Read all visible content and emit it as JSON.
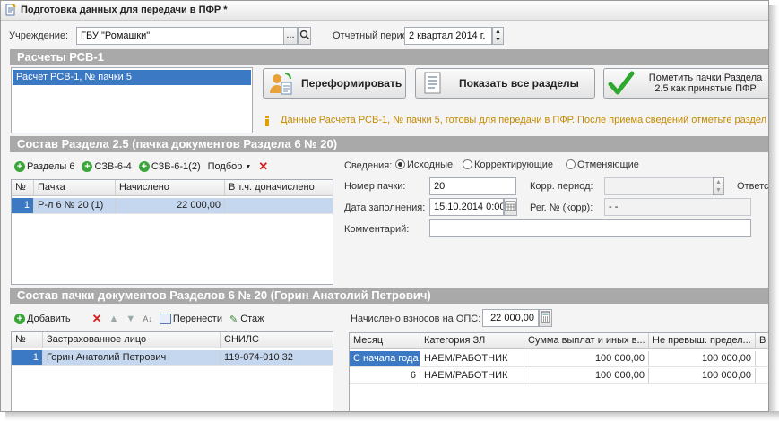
{
  "window": {
    "title": "Подготовка данных для передачи в ПФР *"
  },
  "header": {
    "institution_label": "Учреждение:",
    "institution_value": "ГБУ \"Ромашки\"",
    "ellipsis": "...",
    "period_label": "Отчетный период:",
    "period_value": "2 квартал 2014 г."
  },
  "rsv": {
    "section_title": "Расчеты РСВ-1",
    "list": [
      "Расчет РСВ-1, № пачки 5"
    ],
    "buttons": {
      "reform": "Переформировать",
      "show_all": "Показать все разделы",
      "mark_accepted": "Пометить пачки Раздела 2.5 как принятые ПФР"
    },
    "info_text": "Данные Расчета РСВ-1, № пачки 5, готовы для передачи в ПФР. После приема сведений отметьте раздел"
  },
  "section25": {
    "title": "Состав Раздела 2.5     (пачка документов Раздела 6 № 20)",
    "toolbar": {
      "razdely6": "Разделы 6",
      "szv64": "СЗВ-6-4",
      "szv61": "СЗВ-6-1(2)",
      "podbor": "Подбор"
    },
    "grid_headers": [
      "№",
      "Пачка",
      "Начислено",
      "В т.ч. доначислено"
    ],
    "grid_rows": [
      {
        "num": "1",
        "pack": "Р-л 6 № 20 (1)",
        "charged": "22 000,00",
        "extra": ""
      }
    ],
    "form": {
      "svedeniya_label": "Сведения:",
      "radio_options": [
        "Исходные",
        "Корректирующие",
        "Отменяющие"
      ],
      "pack_number_label": "Номер пачки:",
      "pack_number_value": "20",
      "corr_period_label": "Корр. период:",
      "corr_period_value": "",
      "response_label": "Ответст",
      "fill_date_label": "Дата заполнения:",
      "fill_date_value": "15.10.2014 0:00",
      "reg_corr_label": "Рег. № (корр):",
      "reg_corr_value": "-  -",
      "comment_label": "Комментарий:",
      "comment_value": ""
    }
  },
  "section6": {
    "title": "Состав пачки документов Разделов 6 № 20       (Горин Анатолий Петрович)",
    "toolbar": {
      "add": "Добавить",
      "move": "Перенести",
      "stazh": "Стаж"
    },
    "grid_headers": [
      "№",
      "Застрахованное лицо",
      "СНИЛС"
    ],
    "grid_rows": [
      {
        "num": "1",
        "person": "Горин Анатолий Петрович",
        "snils": "119-074-010 32"
      }
    ],
    "ops_label": "Начислено взносов на ОПС:",
    "ops_value": "22 000,00",
    "month_grid_headers": [
      "Месяц",
      "Категория ЗЛ",
      "Сумма выплат и иных в...",
      "Не превыш. предел...",
      "В д"
    ],
    "month_grid_rows": [
      {
        "month": "С начала года",
        "cat": "НАЕМ/РАБОТНИК",
        "sum": "100 000,00",
        "limit": "100 000,00"
      },
      {
        "month": "6",
        "cat": "НАЕМ/РАБОТНИК",
        "sum": "100 000,00",
        "limit": "100 000,00"
      }
    ]
  },
  "colors": {
    "section_bg": "#a9a9a9",
    "selection": "#3b79c4",
    "accent_green": "#3aa63a",
    "delete_red": "#d62020",
    "info_yellow": "#c38a00"
  }
}
